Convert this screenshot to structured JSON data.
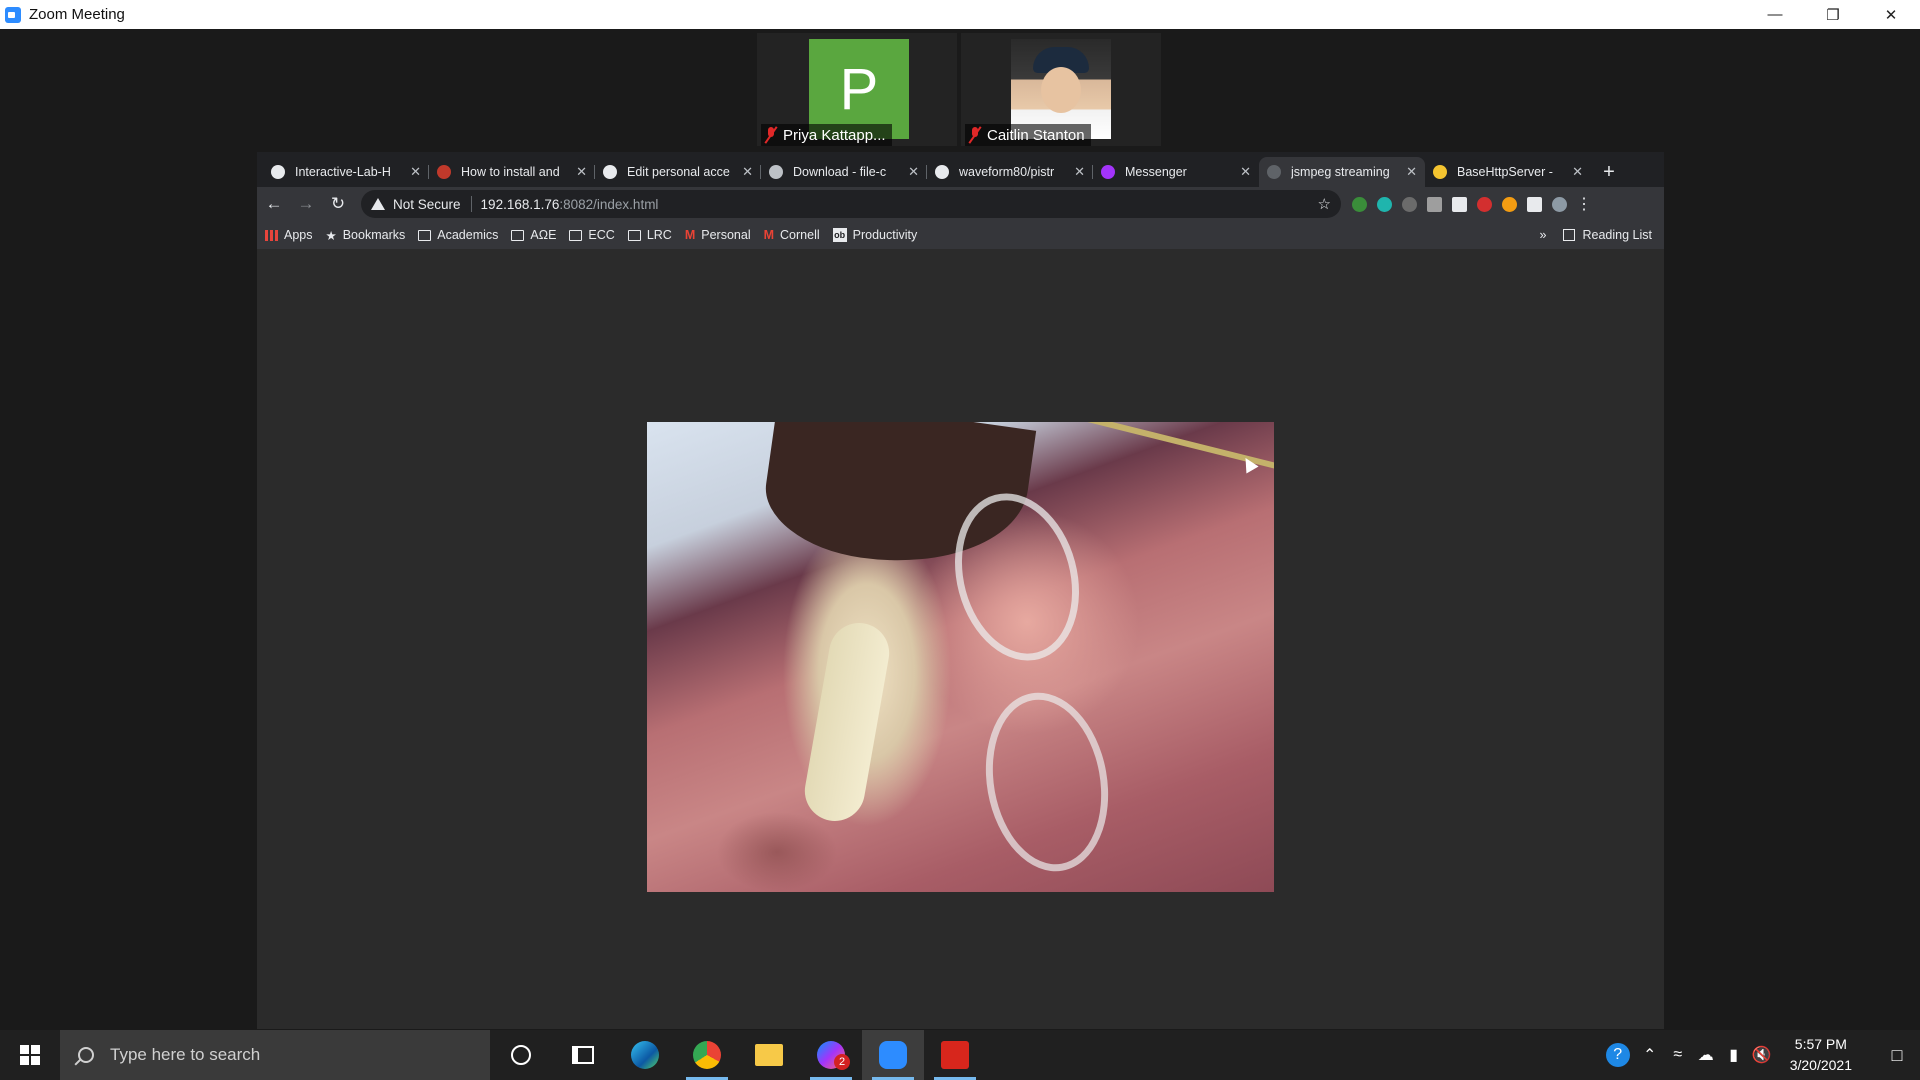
{
  "window": {
    "title": "Zoom Meeting"
  },
  "participants": [
    {
      "initial": "P",
      "name": "Priya Kattapp..."
    },
    {
      "name": "Caitlin Stanton"
    }
  ],
  "browser": {
    "tabs": [
      {
        "label": "Interactive-Lab-H",
        "icon_color": "#e8eaed"
      },
      {
        "label": "How to install and",
        "icon_color": "#c0392b"
      },
      {
        "label": "Edit personal acce",
        "icon_color": "#e8eaed"
      },
      {
        "label": "Download - file-c",
        "icon_color": "#bdc1c6"
      },
      {
        "label": "waveform80/pistr",
        "icon_color": "#e8eaed"
      },
      {
        "label": "Messenger",
        "icon_color": "#a334fa"
      },
      {
        "label": "jsmpeg streaming",
        "icon_color": "#5f6368",
        "active": true
      },
      {
        "label": "BaseHttpServer -",
        "icon_color": "#f4c430"
      }
    ],
    "address": {
      "security": "Not Secure",
      "host": "192.168.1.76",
      "path": ":8082/index.html"
    },
    "bookmarks": [
      {
        "label": "Apps",
        "icon": "apps-icon"
      },
      {
        "label": "Bookmarks",
        "icon": "star-icon"
      },
      {
        "label": "Academics",
        "icon": "folder-icon"
      },
      {
        "label": "AΩE",
        "icon": "folder-icon"
      },
      {
        "label": "ECC",
        "icon": "folder-icon"
      },
      {
        "label": "LRC",
        "icon": "folder-icon"
      },
      {
        "label": "Personal",
        "icon": "gmail-icon"
      },
      {
        "label": "Cornell",
        "icon": "gmail-icon"
      },
      {
        "label": "Productivity",
        "icon": "ob-icon"
      }
    ],
    "reading_list": "Reading List"
  },
  "taskbar": {
    "search_placeholder": "Type here to search",
    "messenger_badge": "2",
    "time": "5:57 PM",
    "date": "3/20/2021"
  }
}
